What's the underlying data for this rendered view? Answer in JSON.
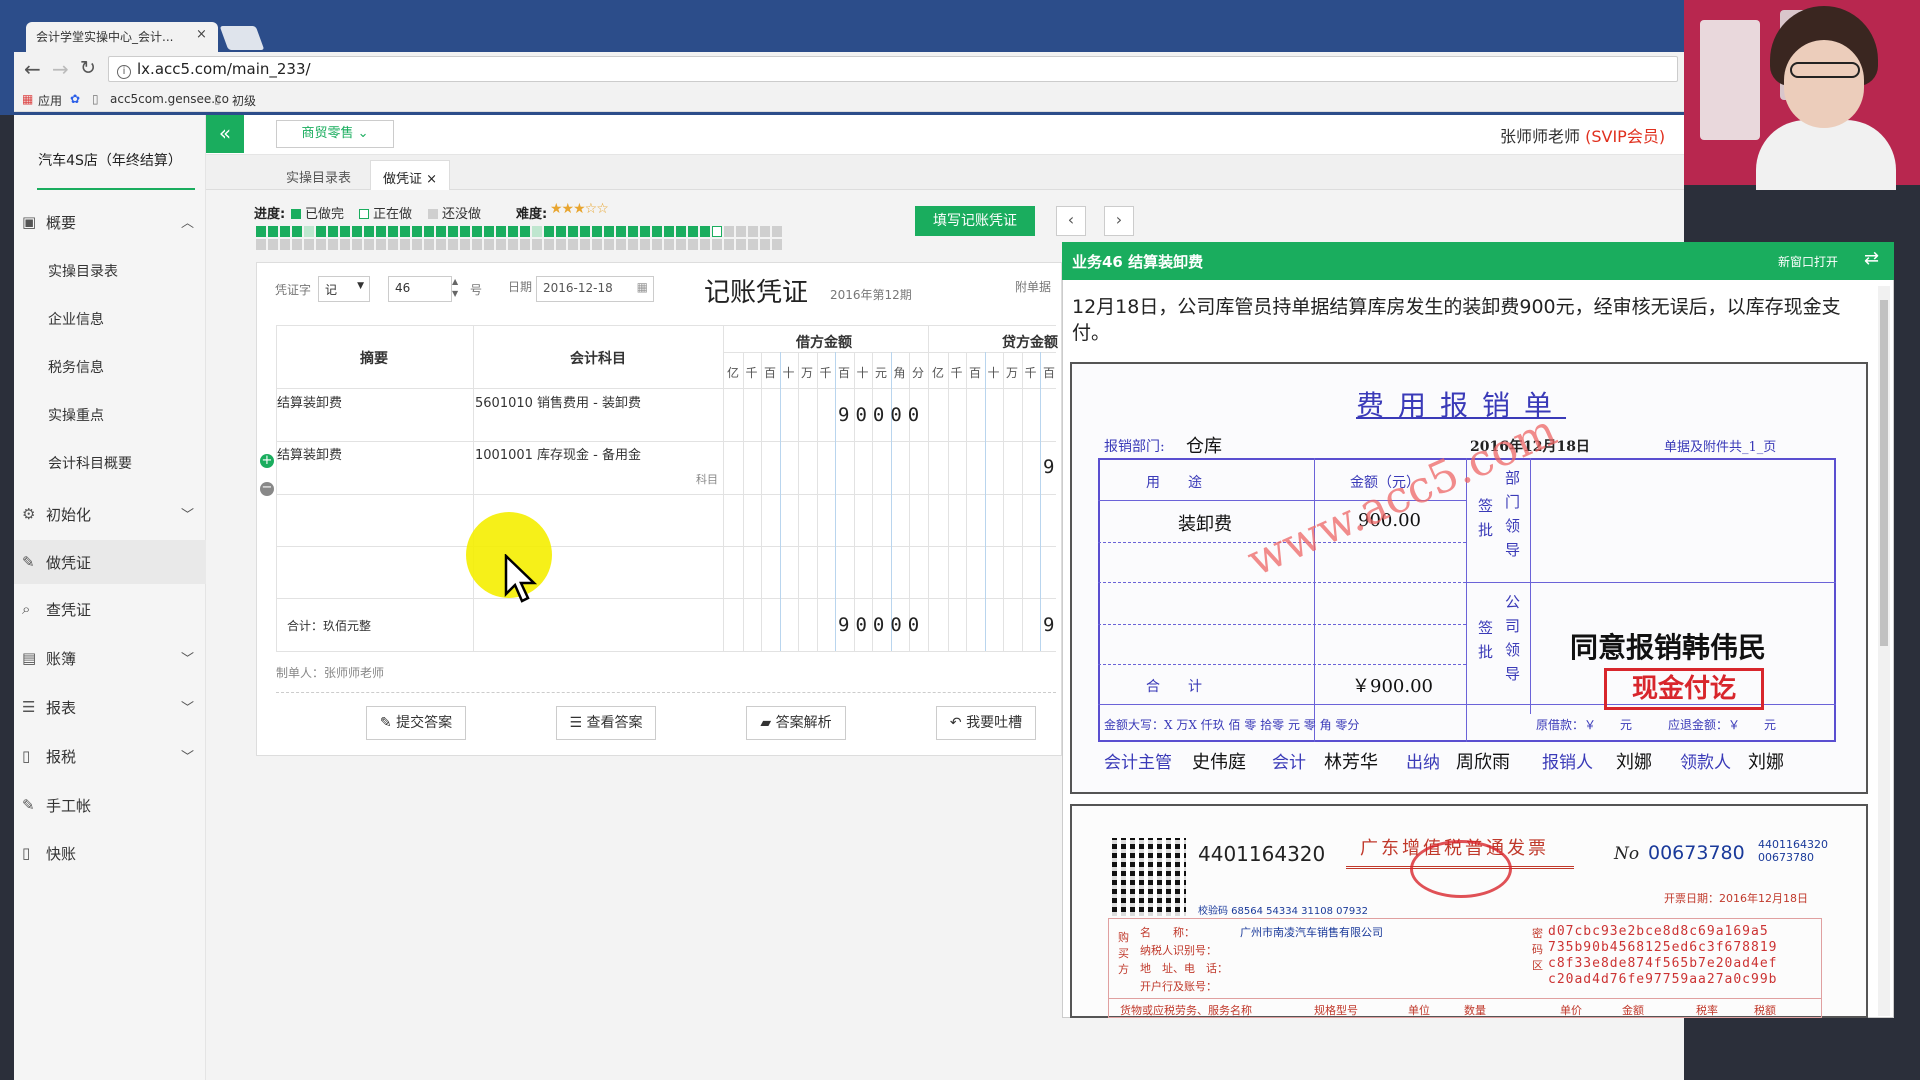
{
  "browser": {
    "tab_title": "会计学堂实操中心_会计...",
    "tab_close": "×",
    "url": "lx.acc5.com/main_233/",
    "bookmarks": [
      "应用",
      "acc5com.gensee.co",
      "初级"
    ]
  },
  "header": {
    "collapse_icon": "«",
    "industry_label": "商贸零售 ⌄",
    "teacher_name": "张师师老师",
    "vip_label": "(SVIP会员)"
  },
  "sidebar": {
    "company": "汽车4S店（年终结算）",
    "items": [
      {
        "label": "概要",
        "icon": "summary-icon"
      },
      {
        "label": "初始化",
        "icon": "gear-icon"
      },
      {
        "label": "做凭证",
        "icon": "pen-icon"
      },
      {
        "label": "查凭证",
        "icon": "search-icon"
      },
      {
        "label": "账簿",
        "icon": "book-icon"
      },
      {
        "label": "报表",
        "icon": "list-icon"
      },
      {
        "label": "报税",
        "icon": "file-icon"
      },
      {
        "label": "手工帐",
        "icon": "pen-icon"
      },
      {
        "label": "快账",
        "icon": "file-icon"
      }
    ],
    "sub_items": [
      "实操目录表",
      "企业信息",
      "税务信息",
      "实操重点",
      "会计科目概要"
    ]
  },
  "page_tabs": {
    "tab1": "实操目录表",
    "tab2": "做凭证",
    "close": "×"
  },
  "progress": {
    "label": "进度:",
    "done": "已做完",
    "doing": "正在做",
    "todo": "还没做",
    "difficulty_label": "难度:",
    "difficulty_stars": "★★★☆☆",
    "done_color": "#1aad5e",
    "todo_color": "#cfcfcf"
  },
  "toolbar": {
    "fill_button": "填写记账凭证",
    "prev": "‹",
    "next": "›"
  },
  "voucher": {
    "word_label": "凭证字",
    "word_value": "记",
    "number": "46",
    "number_suffix": "号",
    "date_label": "日期",
    "date": "2016-12-18",
    "title": "记账凭证",
    "period": "2016年第12期",
    "attachments_label": "附单据",
    "col_summary": "摘要",
    "col_account": "会计科目",
    "col_debit": "借方金额",
    "col_credit": "贷方金额",
    "digit_headers": [
      "亿",
      "千",
      "百",
      "十",
      "万",
      "千",
      "百",
      "十",
      "元",
      "角",
      "分"
    ],
    "rows": [
      {
        "summary": "结算装卸费",
        "account": "5601010 销售费用 - 装卸费",
        "debit": "90000",
        "credit": ""
      },
      {
        "summary": "结算装卸费",
        "account": "1001001 库存现金 - 备用金",
        "debit": "",
        "credit": "9",
        "account_hint": "科目"
      }
    ],
    "total_label": "合计：玖佰元整",
    "total_debit": "90000",
    "total_credit": "9",
    "maker": "制单人：张师师老师"
  },
  "actions": {
    "submit": "提交答案",
    "view": "查看答案",
    "analysis": "答案解析",
    "feedback": "我要吐槽"
  },
  "task": {
    "title": "业务46 结算装卸费",
    "open_new": "新窗口打开",
    "description": "12月18日，公司库管员持单据结算库房发生的装卸费900元，经审核无误后，以库存现金支付。"
  },
  "receipt": {
    "title": "费用报销单",
    "dept_label": "报销部门:",
    "dept": "仓库",
    "date": "2016年12月18日",
    "attachments": "单据及附件共_1_页",
    "col_use": "用　　途",
    "col_amount": "金额（元）",
    "dept_leader": "部门领导",
    "item": "装卸费",
    "item_amount": "900.00",
    "total_label": "合　　计",
    "total_amount": "￥900.00",
    "company_leader": "公司领导",
    "sign_label": "签批",
    "approve_text": "同意报销韩伟民",
    "stamp": "现金付讫",
    "amount_words": "金额大写：X 万X 仟玖 佰 零 拾零 元 零 角 零分",
    "borrowed": "原借款：￥　　元",
    "refund": "应退金额：￥　　元",
    "supervisor_label": "会计主管",
    "supervisor": "史伟庭",
    "accountant_label": "会计",
    "accountant": "林芳华",
    "cashier_label": "出纳",
    "cashier": "周欣雨",
    "claimant_label": "报销人",
    "claimant": "刘娜",
    "receiver_label": "领款人",
    "receiver": "刘娜",
    "watermark": "www.acc5.com"
  },
  "invoice": {
    "code": "4401164320",
    "title": "广东增值税普通发票",
    "no_label": "No",
    "no": "00673780",
    "side_code": "4401164320",
    "side_no": "00673780",
    "issue_date": "开票日期：2016年12月18日",
    "check_code": "校验码 68564 54334 31108 07932",
    "buyer_name_label": "名　　称：",
    "buyer_name": "广州市南凌汽车销售有限公司",
    "buyer_tax_label": "纳税人识别号：",
    "buyer_addr_label": "地　址、电　话：",
    "buyer_bank_label": "开户行及账号：",
    "buyer_side": "购买方",
    "password_side": "密码区",
    "hash": [
      "d07cbc93e2bce8d8c69a169a5",
      "735b90b4568125ed6c3f678819",
      "c8f33e8de874f565b7e20ad4ef",
      "c20ad4d76fe97759aa27a0c99b"
    ],
    "goods_header": "货物或应税劳务、服务名称",
    "spec": "规格型号",
    "unit": "单位",
    "qty": "数量",
    "price": "单价",
    "amount": "金额",
    "tax_rate": "税率",
    "tax": "税额"
  }
}
